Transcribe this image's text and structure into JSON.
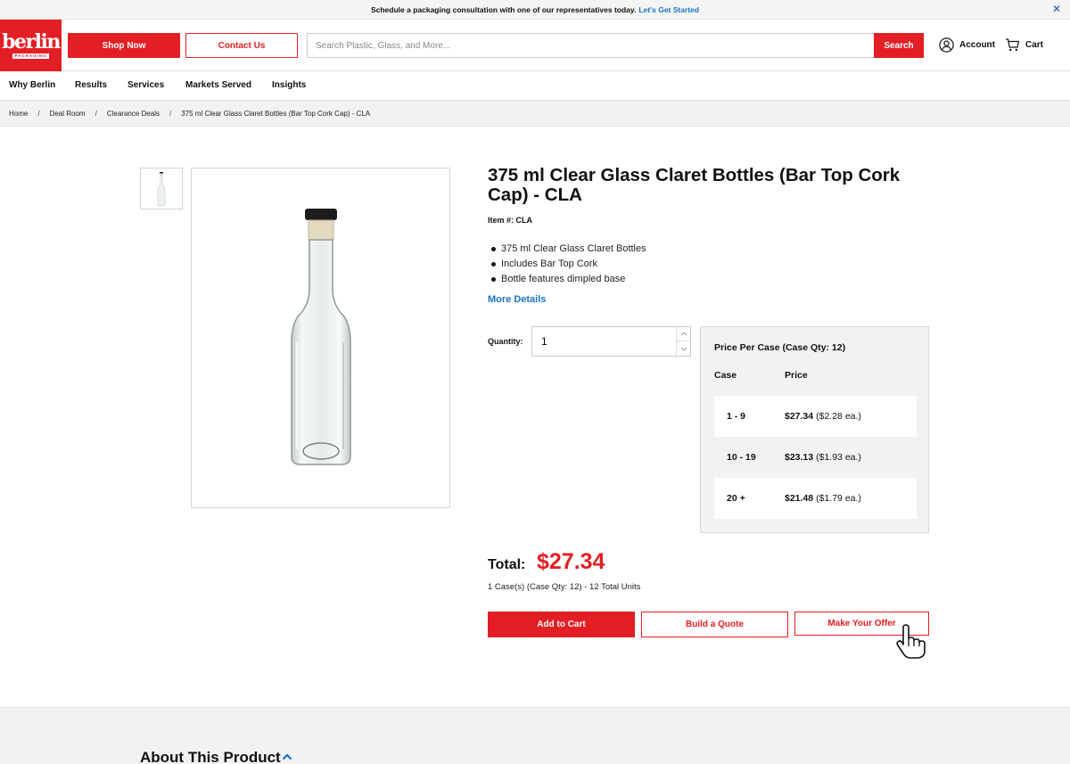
{
  "banner": {
    "text": "Schedule a packaging consultation with one of our representatives today.",
    "link": "Let's Get Started"
  },
  "header": {
    "logo_word": "berlin",
    "logo_sub": "PACKAGING",
    "shop_label": "Shop Now",
    "contact_label": "Contact Us",
    "search_placeholder": "Search Plastic, Glass, and More...",
    "search_label": "Search",
    "account_label": "Account",
    "cart_label": "Cart"
  },
  "nav": {
    "items": [
      "Why Berlin",
      "Results",
      "Services",
      "Markets Served",
      "Insights"
    ]
  },
  "breadcrumb": [
    "Home",
    "Deal Room",
    "Clearance Deals",
    "375 ml Clear Glass Claret Bottles (Bar Top Cork Cap) - CLA"
  ],
  "product": {
    "title": "375 ml Clear Glass Claret Bottles (Bar Top Cork Cap) - CLA",
    "item_number": "Item #: CLA",
    "features": [
      "375 ml Clear Glass Claret Bottles",
      "Includes Bar Top Cork",
      "Bottle features dimpled base"
    ],
    "more_details": "More Details",
    "quantity_label": "Quantity:",
    "quantity_value": "1"
  },
  "pricing": {
    "title": "Price Per Case (Case Qty: 12)",
    "col_case": "Case",
    "col_price": "Price",
    "tiers": [
      {
        "qty": "1 - 9",
        "price": "$27.34",
        "each": "($2.28 ea.)"
      },
      {
        "qty": "10 - 19",
        "price": "$23.13",
        "each": "($1.93 ea.)"
      },
      {
        "qty": "20 +",
        "price": "$21.48",
        "each": "($1.79 ea.)"
      }
    ]
  },
  "total": {
    "label": "Total:",
    "value": "$27.34",
    "units": "1 Case(s) (Case Qty: 12) - 12 Total Units"
  },
  "actions": {
    "add_to_cart": "Add to Cart",
    "build_quote": "Build a Quote",
    "make_offer": "Make Your Offer"
  },
  "about": {
    "title": "About This Product"
  },
  "colors": {
    "brand_red": "#e31e24",
    "link_blue": "#1b73c7"
  }
}
